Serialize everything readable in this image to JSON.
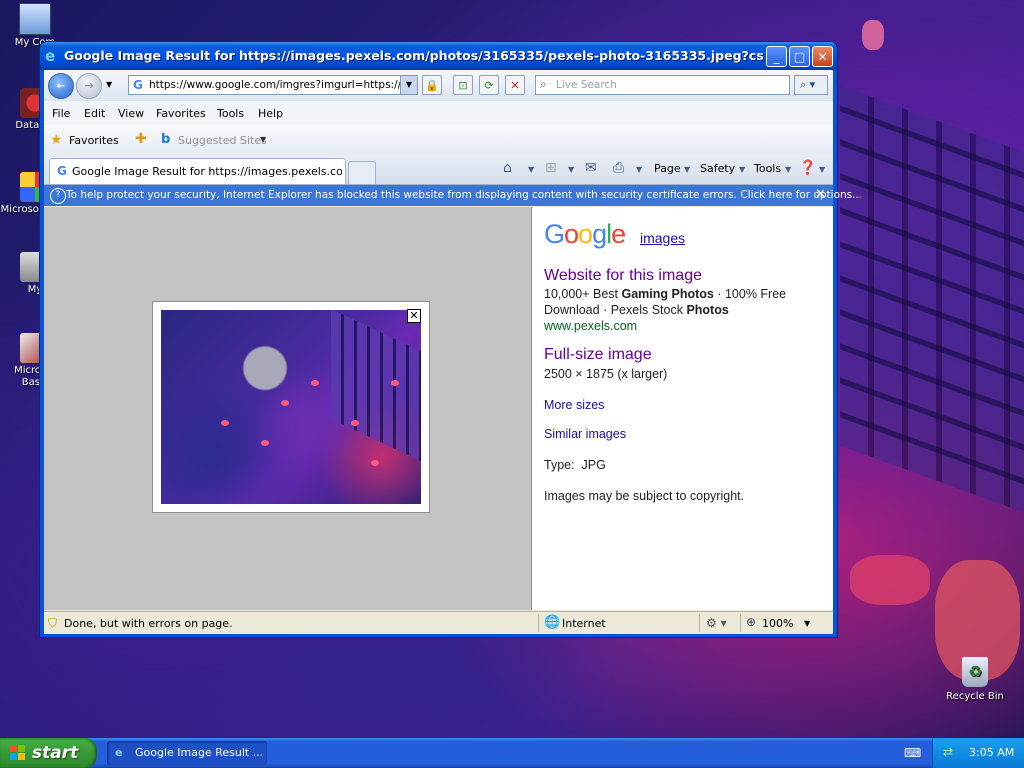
{
  "desktop": {
    "icons": [
      {
        "label": "My Com"
      },
      {
        "label": "DataWa"
      },
      {
        "label": "Microsof C++"
      },
      {
        "label": "My"
      },
      {
        "label": "Microsof Basic"
      }
    ],
    "recycle_bin": "Recycle Bin"
  },
  "window": {
    "title": "Google Image Result for https://images.pexels.com/photos/3165335/pexels-photo-3165335.jpeg?cs=s - Windo...",
    "address": "https://www.google.com/imgres?imgurl=https://ima",
    "search_placeholder": "Live Search",
    "menu": [
      "File",
      "Edit",
      "View",
      "Favorites",
      "Tools",
      "Help"
    ],
    "favorites_label": "Favorites",
    "suggested_sites": "Suggested Sites",
    "tab_title": "Google Image Result for https://images.pexels.com/p...",
    "commands": {
      "page": "Page",
      "safety": "Safety",
      "tools": "Tools"
    },
    "infobar": "To help protect your security, Internet Explorer has blocked this website from displaying content with security certificate errors. Click here for options...",
    "status_text": "Done, but with errors on page.",
    "zone": "Internet",
    "zoom": "100%"
  },
  "result": {
    "logo_text": "Google",
    "images_link": "images",
    "website_heading": "Website for this image",
    "desc_line1_pre": "10,000+ Best ",
    "desc_line1_bold": "Gaming Photos",
    "desc_line1_post": " · 100% Free",
    "desc_line2_pre": "Download · Pexels Stock ",
    "desc_line2_bold": "Photos",
    "site_url": "www.pexels.com",
    "fullsize_heading": "Full-size image",
    "dimensions": "2500 × 1875 (x larger)",
    "more_sizes": "More sizes",
    "similar_images": "Similar images",
    "type_label": "Type:",
    "type_value": "JPG",
    "copyright": "Images may be subject to copyright."
  },
  "taskbar": {
    "start": "start",
    "task_item": "Google Image Result ...",
    "clock": "3:05 AM"
  }
}
